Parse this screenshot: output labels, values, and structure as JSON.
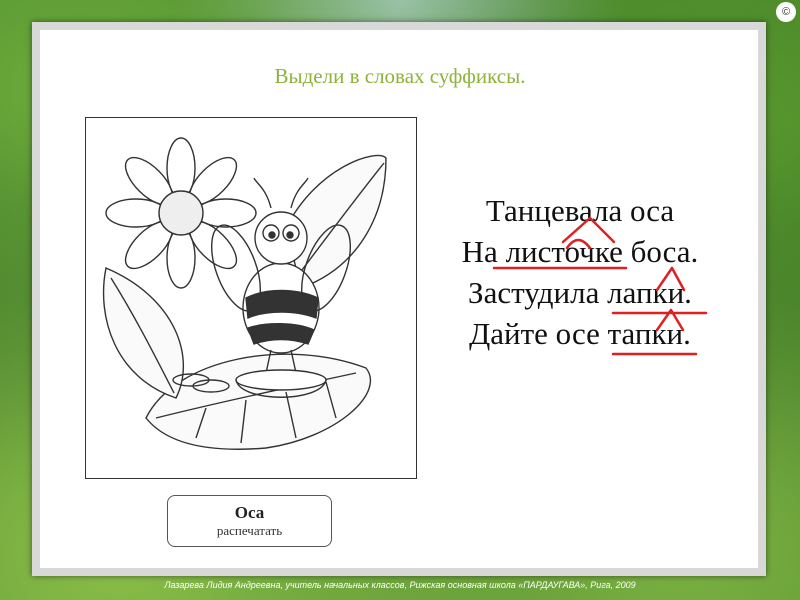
{
  "slide": {
    "title": "Выдели в словах суффиксы.",
    "corner_label": "©"
  },
  "poem": {
    "lines": [
      "Танцевала оса",
      "На листочке боса.",
      "Застудила лапки.",
      "Дайте осе тапки."
    ]
  },
  "print_button": {
    "title": "Оса",
    "subtitle": "распечатать"
  },
  "footer": {
    "text": "Лазарева Лидия Андреевна, учитель начальных классов, Рижская основная школа «ПАРДАУГАВА», Рига, 2009"
  },
  "colors": {
    "title": "#8db33a",
    "markup": "#e02020"
  }
}
